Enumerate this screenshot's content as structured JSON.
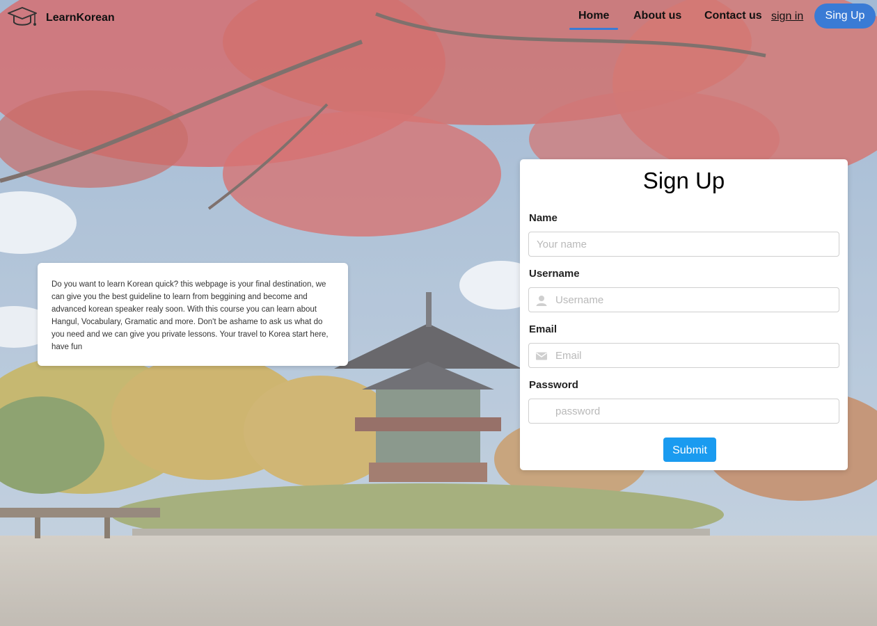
{
  "nav": {
    "brand": "LearnKorean",
    "logo_icon": "graduation-cap-icon",
    "links": {
      "home": "Home",
      "about": "About us",
      "contact": "Contact us",
      "signin": "sign in",
      "signup": "Sing Up"
    },
    "accent_color": "#3a7bd5"
  },
  "info": {
    "text": "Do you want to learn Korean quick? this webpage is your final destination, we can give you the best guideline to learn from beggining and become and advanced korean speaker realy soon. With this course you can learn about Hangul, Vocabulary, Gramatic and more. Don't be ashame to ask us what do you need and we can give you private lessons. Your travel to Korea start here, have fun"
  },
  "form": {
    "title": "Sign Up",
    "fields": {
      "name": {
        "label": "Name",
        "placeholder": "Your name",
        "value": ""
      },
      "username": {
        "label": "Username",
        "placeholder": "Username",
        "value": "",
        "icon": "user-icon"
      },
      "email": {
        "label": "Email",
        "placeholder": "Email",
        "value": "",
        "icon": "envelope-icon"
      },
      "password": {
        "label": "Password",
        "placeholder": "password",
        "value": ""
      }
    },
    "submit_label": "Submit",
    "submit_color": "#1a9bf0"
  },
  "background": {
    "scene": "autumn-pavilion-photo"
  }
}
